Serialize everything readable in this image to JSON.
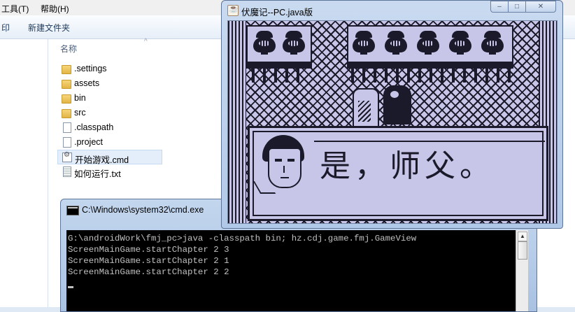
{
  "explorer": {
    "menu": {
      "tools": "工具(T)",
      "help": "帮助(H)"
    },
    "toolbar": {
      "print_fragment": "印",
      "new_folder": "新建文件夹"
    },
    "column_header": {
      "name": "名称",
      "sort_icon": "sort-up-icon"
    },
    "files": [
      {
        "name": ".settings",
        "icon": "folder-icon"
      },
      {
        "name": "assets",
        "icon": "folder-icon"
      },
      {
        "name": "bin",
        "icon": "folder-icon"
      },
      {
        "name": "src",
        "icon": "folder-icon"
      },
      {
        "name": ".classpath",
        "icon": "document-icon"
      },
      {
        "name": ".project",
        "icon": "document-icon"
      },
      {
        "name": "开始游戏.cmd",
        "icon": "cmd-script-icon",
        "selected": true
      },
      {
        "name": "如何运行.txt",
        "icon": "text-file-icon"
      }
    ]
  },
  "cmd": {
    "title": "C:\\Windows\\system32\\cmd.exe",
    "lines": [
      "G:\\androidWork\\fmj_pc>java -classpath bin; hz.cdj.game.fmj.GameView",
      "ScreenMainGame.startChapter 2 3",
      "ScreenMainGame.startChapter 2 1",
      "ScreenMainGame.startChapter 2 2"
    ]
  },
  "game": {
    "title": "伏魔记--PC.java版",
    "dialog_text": "是，师父。",
    "colors": {
      "palette_bg": "#c8c6e8",
      "palette_ink": "#1a1a2a"
    }
  }
}
